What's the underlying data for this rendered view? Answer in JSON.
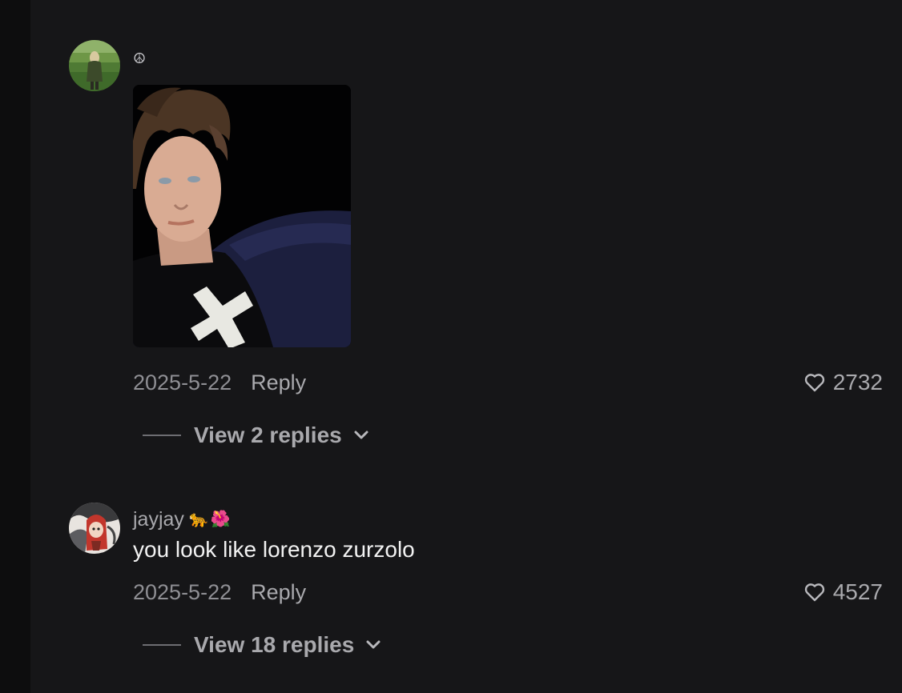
{
  "comments": [
    {
      "username": "☮",
      "username_emoji": [],
      "has_image": true,
      "text": "",
      "date": "2025-5-22",
      "reply_label": "Reply",
      "like_count": "2732",
      "view_replies": "View 2 replies",
      "avatar_icon": "person-in-field-avatar"
    },
    {
      "username": "jayjay",
      "username_emoji": [
        "🐆",
        "🌺"
      ],
      "has_image": false,
      "text": "you look like lorenzo zurzolo",
      "date": "2025-5-22",
      "reply_label": "Reply",
      "like_count": "4527",
      "view_replies": "View 18 replies",
      "avatar_icon": "illustrated-character-avatar"
    }
  ],
  "colors": {
    "background": "#161618",
    "text_primary": "#f2f2f2",
    "text_secondary": "#a9a9ad",
    "text_muted": "#8f8f94"
  }
}
